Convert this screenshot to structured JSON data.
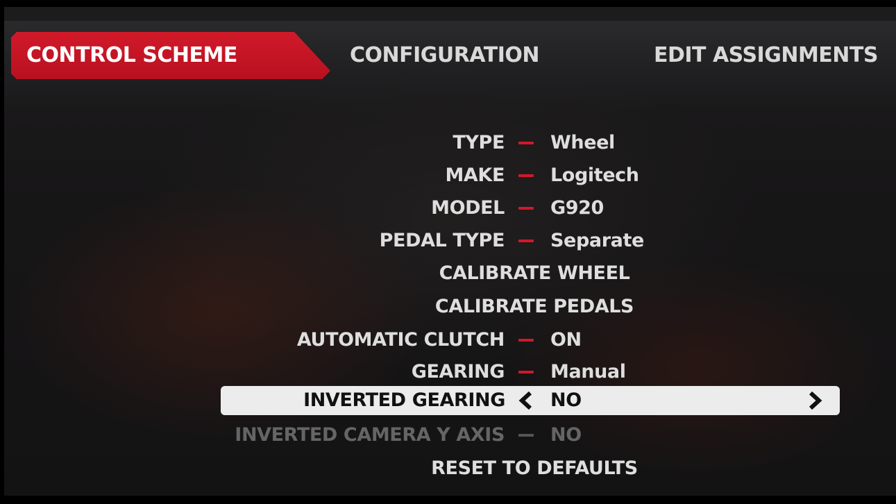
{
  "tabs": {
    "control_scheme": "CONTROL SCHEME",
    "configuration": "CONFIGURATION",
    "edit_assignments": "EDIT ASSIGNMENTS"
  },
  "menu": {
    "type": {
      "label": "TYPE",
      "value": "Wheel"
    },
    "make": {
      "label": "MAKE",
      "value": "Logitech"
    },
    "model": {
      "label": "MODEL",
      "value": "G920"
    },
    "pedal_type": {
      "label": "PEDAL TYPE",
      "value": "Separate"
    },
    "calibrate_wheel": {
      "label": "CALIBRATE WHEEL"
    },
    "calibrate_pedals": {
      "label": "CALIBRATE PEDALS"
    },
    "automatic_clutch": {
      "label": "AUTOMATIC CLUTCH",
      "value": "ON"
    },
    "gearing": {
      "label": "GEARING",
      "value": "Manual"
    },
    "inverted_gearing": {
      "label": "INVERTED GEARING",
      "value": "NO"
    },
    "inverted_camera_y_axis": {
      "label": "INVERTED CAMERA Y AXIS",
      "value": "NO"
    },
    "reset_to_defaults": {
      "label": "RESET TO DEFAULTS"
    }
  },
  "icons": {
    "arrow_left": "chevron-left-icon",
    "arrow_right": "chevron-right-icon",
    "separator": "dash-icon"
  },
  "colors": {
    "accent": "#c8101f",
    "selected_bg": "#ececec",
    "text": "#dedede",
    "disabled_text": "#666565"
  }
}
